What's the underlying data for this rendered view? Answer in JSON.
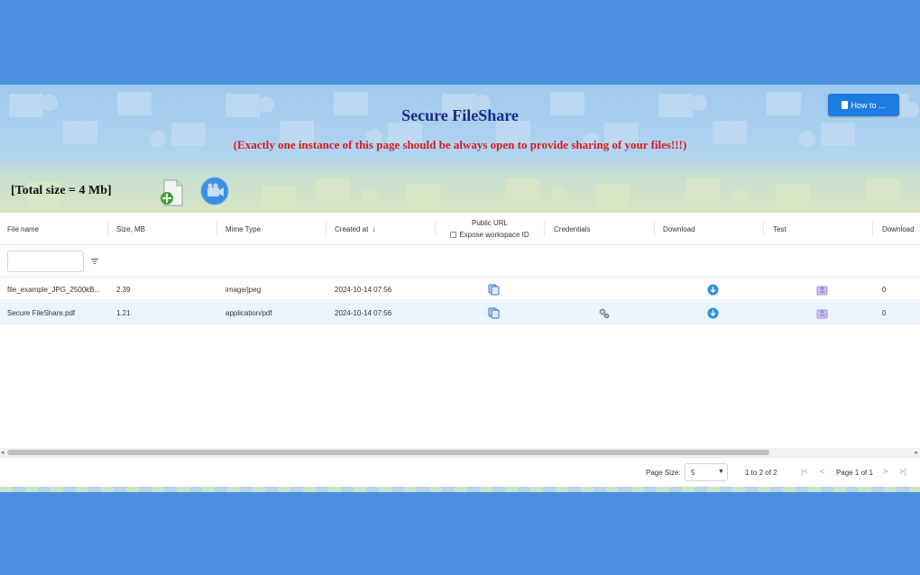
{
  "header": {
    "title": "Secure FileShare",
    "subtitle": "(Exactly one instance of this page should be always open to provide sharing of your files!!!)",
    "howto_label": "How to ...",
    "total_size": "[Total size = 4 Mb]"
  },
  "icons": {
    "add_file": "add-file-icon",
    "camera": "camera-icon",
    "copy": "copy-icon",
    "download": "download-icon",
    "test": "test-icon",
    "credentials": "credentials-icon",
    "filter": "filter-icon",
    "doc": "document-icon"
  },
  "columns": {
    "file_name": "File name",
    "size": "Size, MB",
    "mime": "Mime Type",
    "created": "Created at",
    "public_url": "Public URL",
    "expose": "Expose workspace ID",
    "credentials": "Credentials",
    "download": "Download",
    "test": "Test",
    "downloads": "Download"
  },
  "filter": {
    "value": ""
  },
  "rows": [
    {
      "file_name": "file_example_JPG_2500kB...",
      "size": "2.39",
      "mime": "image/jpeg",
      "created": "2024-10-14 07:56",
      "has_credentials": false,
      "downloads": "0"
    },
    {
      "file_name": "Secure FileShare.pdf",
      "size": "1.21",
      "mime": "application/pdf",
      "created": "2024-10-14 07:56",
      "has_credentials": true,
      "downloads": "0"
    }
  ],
  "pagination": {
    "page_size_label": "Page Size:",
    "page_size": "5",
    "range": "1 to 2 of 2",
    "page": "Page 1 of 1"
  },
  "colors": {
    "outer_background": "#4a8fe0",
    "title": "#1a2a8a",
    "subtitle": "#d81b1b",
    "button": "#1e7be0",
    "row_highlight": "#eaf4fb"
  }
}
